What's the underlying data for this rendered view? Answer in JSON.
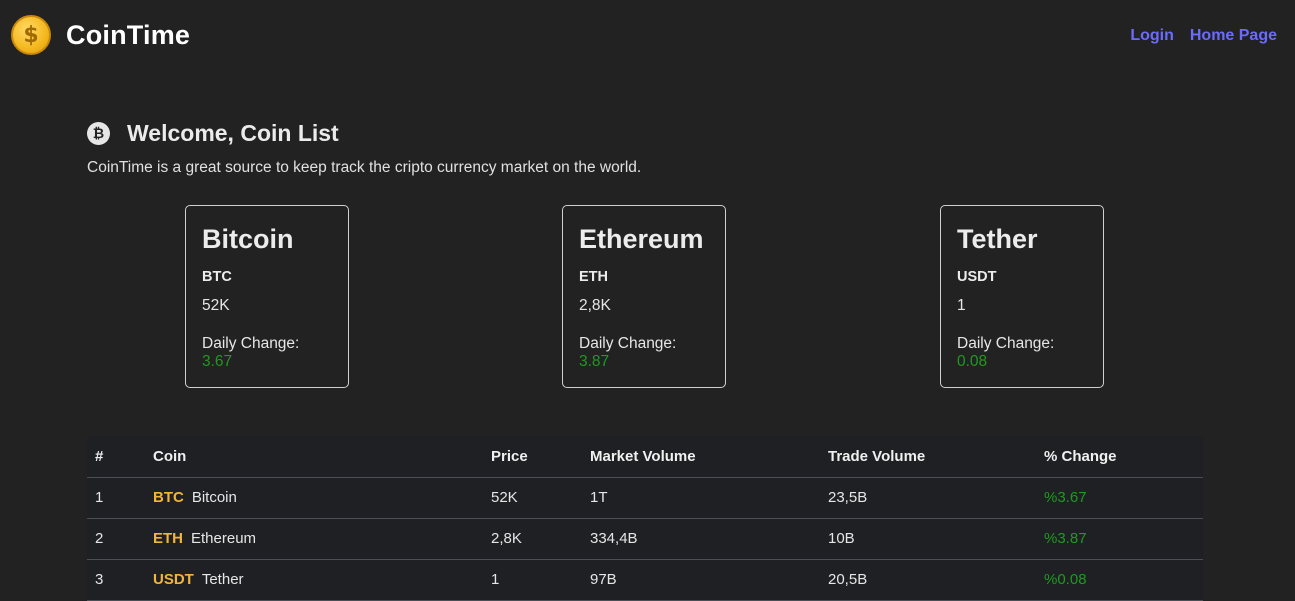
{
  "header": {
    "brand_name": "CoinTime",
    "logo_icon": "dollar-coin-icon",
    "nav": [
      {
        "label": "Login"
      },
      {
        "label": "Home Page"
      }
    ],
    "accent_color": "#6b6bff"
  },
  "welcome": {
    "icon": "bitcoin-icon",
    "title": "Welcome, Coin List",
    "description": "CoinTime is a great source to keep track the cripto currency market on the world."
  },
  "cards": [
    {
      "name": "Bitcoin",
      "symbol": "BTC",
      "price": "52K",
      "change_label": "Daily Change:",
      "change": "3.67"
    },
    {
      "name": "Ethereum",
      "symbol": "ETH",
      "price": "2,8K",
      "change_label": "Daily Change:",
      "change": "3.87"
    },
    {
      "name": "Tether",
      "symbol": "USDT",
      "price": "1",
      "change_label": "Daily Change:",
      "change": "0.08"
    }
  ],
  "table": {
    "headers": [
      "#",
      "Coin",
      "Price",
      "Market Volume",
      "Trade Volume",
      "% Change"
    ],
    "rows": [
      {
        "index": "1",
        "symbol": "BTC",
        "name": "Bitcoin",
        "price": "52K",
        "market_volume": "1T",
        "trade_volume": "23,5B",
        "change": "%3.67"
      },
      {
        "index": "2",
        "symbol": "ETH",
        "name": "Ethereum",
        "price": "2,8K",
        "market_volume": "334,4B",
        "trade_volume": "10B",
        "change": "%3.87"
      },
      {
        "index": "3",
        "symbol": "USDT",
        "name": "Tether",
        "price": "1",
        "market_volume": "97B",
        "trade_volume": "20,5B",
        "change": "%0.08"
      }
    ]
  },
  "colors": {
    "background": "#222222",
    "positive": "#1f9a1f",
    "symbol": "#f2b53a"
  }
}
